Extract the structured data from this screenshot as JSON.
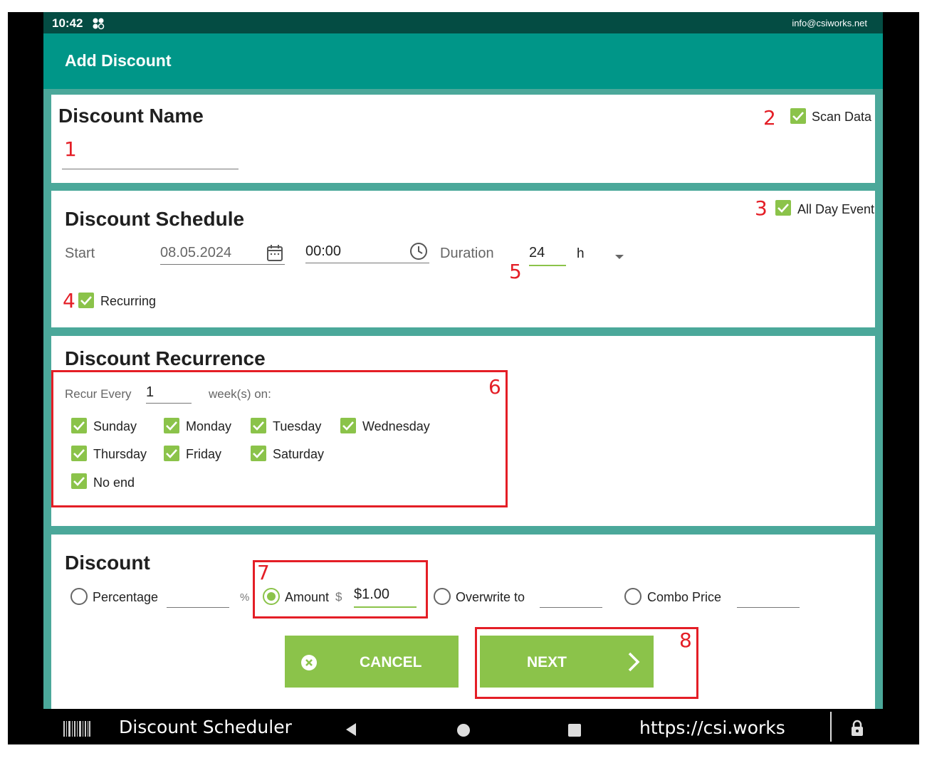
{
  "status": {
    "time": "10:42",
    "email": "info@csiworks.net"
  },
  "appbar": {
    "title": "Add Discount"
  },
  "name_card": {
    "heading": "Discount Name",
    "name_value": "",
    "scan_data_label": "Scan Data",
    "scan_data_checked": true
  },
  "schedule": {
    "heading": "Discount Schedule",
    "all_day_label": "All Day Event",
    "all_day_checked": true,
    "start_label": "Start",
    "start_date": "08.05.2024",
    "start_time": "00:00",
    "duration_label": "Duration",
    "duration_value": "24",
    "duration_unit": "h",
    "recurring_label": "Recurring",
    "recurring_checked": true
  },
  "recurrence": {
    "heading": "Discount Recurrence",
    "recur_every_label": "Recur Every",
    "recur_every_value": "1",
    "weeks_label": "week(s) on:",
    "days": [
      {
        "label": "Sunday",
        "checked": true
      },
      {
        "label": "Monday",
        "checked": true
      },
      {
        "label": "Tuesday",
        "checked": true
      },
      {
        "label": "Wednesday",
        "checked": true
      },
      {
        "label": "Thursday",
        "checked": true
      },
      {
        "label": "Friday",
        "checked": true
      },
      {
        "label": "Saturday",
        "checked": true
      }
    ],
    "no_end_label": "No end",
    "no_end_checked": true
  },
  "discount": {
    "heading": "Discount",
    "percentage_label": "Percentage",
    "percent_sign": "%",
    "amount_label": "Amount",
    "dollar_sign": "$",
    "amount_value": "$1.00",
    "overwrite_label": "Overwrite to",
    "combo_label": "Combo Price",
    "selected": "amount"
  },
  "buttons": {
    "cancel": "CANCEL",
    "next": "NEXT"
  },
  "navbar": {
    "app_label": "Discount Scheduler",
    "url": "https://csi.works"
  },
  "annotations": [
    "1",
    "2",
    "3",
    "4",
    "5",
    "6",
    "7",
    "8"
  ],
  "colors": {
    "accent": "#8bc34a",
    "appbar": "#009688",
    "statusbar": "#044c43",
    "annotation": "#e41e26"
  }
}
